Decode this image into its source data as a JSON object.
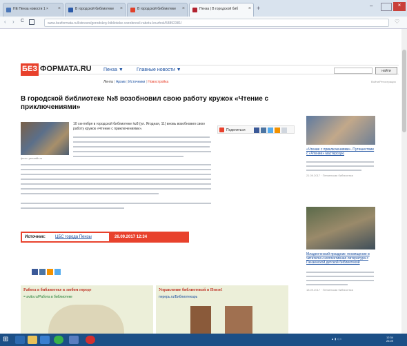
{
  "browser": {
    "tabs": [
      {
        "label": "НЕ Пенза новости 1 ×",
        "color": "#4a76b8"
      },
      {
        "label": "В городской библиотеке",
        "color": "#2b5aa8"
      },
      {
        "label": "В городской библиотеке",
        "color": "#e0402a"
      },
      {
        "label": "Пенза | В городской биб",
        "color": "#b22230"
      }
    ],
    "new_tab_label": "+",
    "url": "www.bezformata.ru/listnews/gorodskoy-biblioteke-vozobnovil-rabotu-kruzhok/58892381/"
  },
  "site": {
    "logo_prefix": "БЕЗ",
    "logo_main": "ФОРМАТА.RU",
    "city_dropdown": "Пенза ▼",
    "main_news_dropdown": "Главные новости ▼",
    "nav_links": [
      "Лента",
      "Архив",
      "Источники",
      "Новостройка"
    ],
    "search_placeholder": "",
    "search_button": "найти",
    "top_right_link": "Войти/Регистрация"
  },
  "article": {
    "title": "В городской библиотеке №8 возобновил свою работу кружок «Чтение с приключениями»",
    "photo_caption": "фото: penzalib.ru",
    "lead": "10 сентября в городской библиотеке №8 (ул. Ягодная, 11) вновь возобновил свою работу кружок «Чтение с приключениями».",
    "share_button": "Поделиться",
    "source_label": "Источник:",
    "source_name": "ЦБС города Пензы",
    "source_datetime": "26.09.2017 12:34"
  },
  "bottom_blocks": [
    {
      "title": "Работа в библиотеке в любом городе",
      "sub": "= avito.ru/Работа в библиотеке"
    },
    {
      "title": "Управление библиотекой в Пензе!",
      "sub": "перерь.ru/Библиотекарь"
    }
  ],
  "sidebar": {
    "item1_link": "«Чтение с приключениями». Путешествие с «Чтение» мастерскую",
    "item1_date": "21.09.2017 · Пензенская библиотека",
    "item2_link": "Младенческий праздник: посвящение в читатели и коллективная литература с Пензенской детской библиотекой",
    "item2_date": "18.09.2017 · Пензенская библиотека"
  },
  "colors": {
    "brand_red": "#e8412c",
    "link_blue": "#1a4fa0",
    "taskbar": "#1c4f86"
  }
}
